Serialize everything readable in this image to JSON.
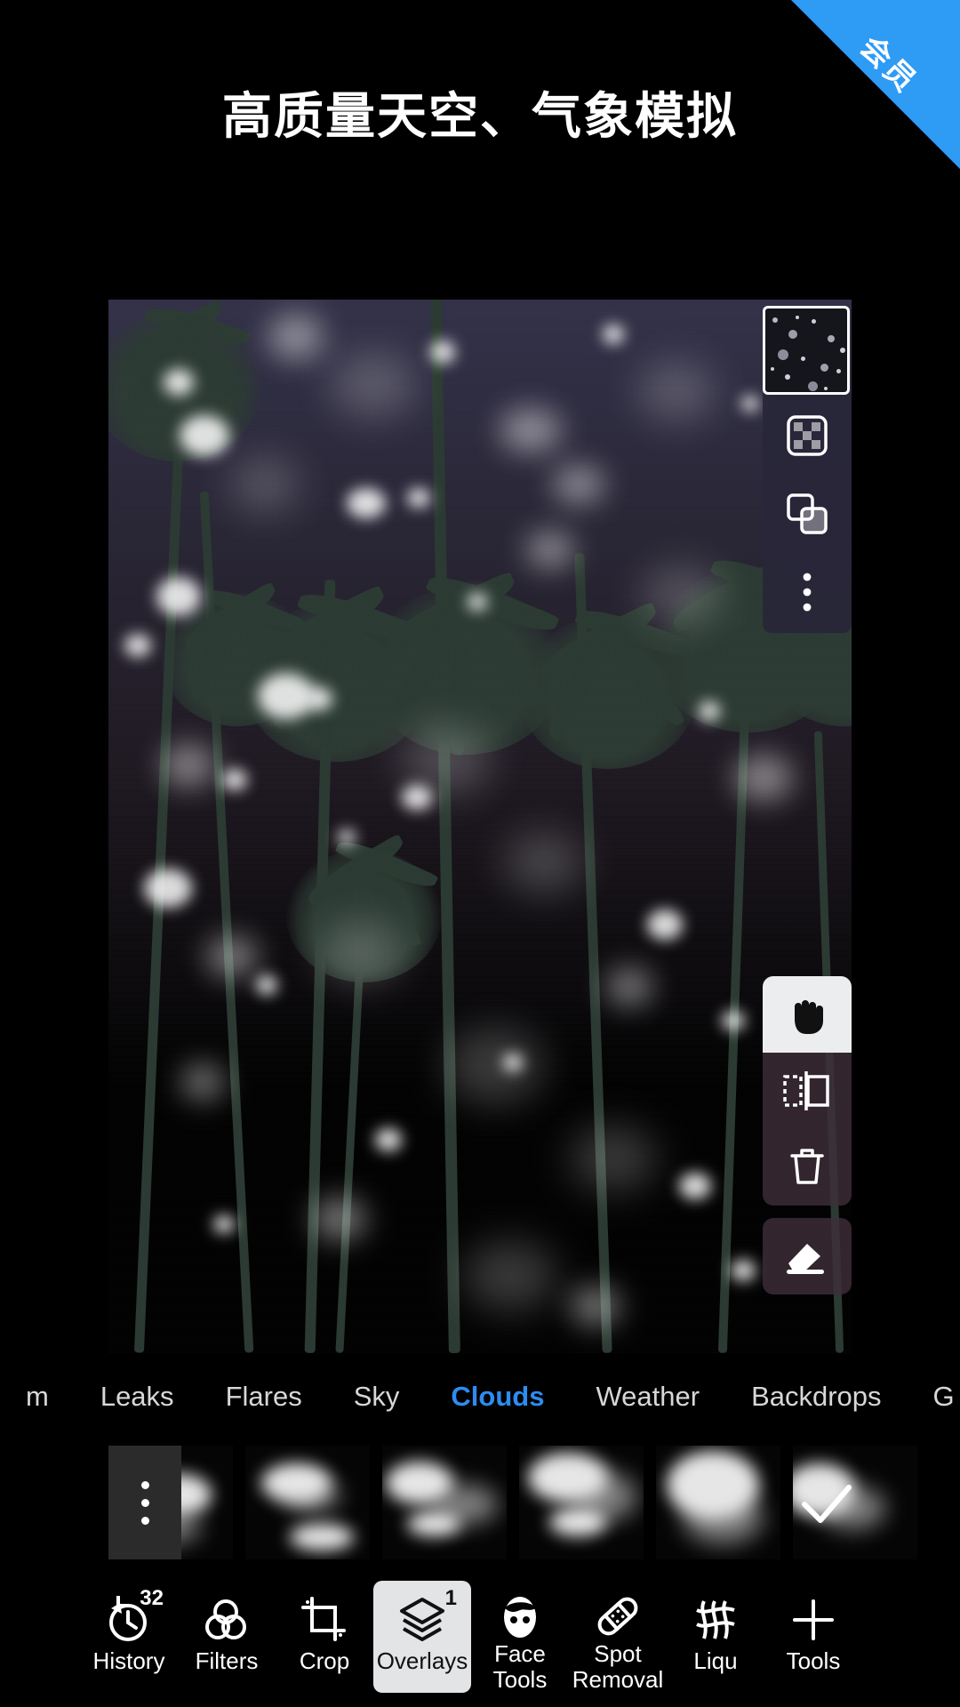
{
  "ribbon": {
    "label": "会员",
    "color": "#2e9bf5"
  },
  "headline": {
    "text": "高质量天空、气象模拟"
  },
  "canvas": {
    "name": "photo-canvas",
    "description": "palm trees silhouette against purple-to-pink gradient sky with bokeh light overlay"
  },
  "layers_panel": {
    "thumbnail_name": "overlay-layer-thumbnail",
    "buttons": [
      {
        "name": "opacity-mask-button",
        "icon": "checkerboard-icon"
      },
      {
        "name": "blend-mode-button",
        "icon": "overlapping-squares-icon"
      },
      {
        "name": "layer-more-button",
        "icon": "more-vertical-icon"
      }
    ]
  },
  "tool_panel": {
    "buttons": [
      {
        "name": "move-tool",
        "icon": "hand-icon",
        "selected": true
      },
      {
        "name": "flip-tool",
        "icon": "flip-horizontal-icon",
        "selected": false
      },
      {
        "name": "delete-tool",
        "icon": "trash-icon",
        "selected": false
      },
      {
        "name": "erase-tool",
        "icon": "eraser-icon",
        "selected": false
      }
    ]
  },
  "tabs": {
    "items": [
      {
        "label": "m",
        "active": false,
        "clipped": true
      },
      {
        "label": "Leaks",
        "active": false
      },
      {
        "label": "Flares",
        "active": false
      },
      {
        "label": "Sky",
        "active": false
      },
      {
        "label": "Clouds",
        "active": true
      },
      {
        "label": "Weather",
        "active": false
      },
      {
        "label": "Backdrops",
        "active": false
      },
      {
        "label": "G",
        "active": false,
        "clipped": true
      }
    ],
    "active_color": "#2d8cf0"
  },
  "carousel": {
    "more_button": "overlay-more-options",
    "confirm_button": "confirm-check-button",
    "thumbnails": [
      {
        "name": "cloud-thumb-1"
      },
      {
        "name": "cloud-thumb-2"
      },
      {
        "name": "cloud-thumb-3"
      },
      {
        "name": "cloud-thumb-4"
      },
      {
        "name": "cloud-thumb-5"
      },
      {
        "name": "cloud-thumb-6"
      }
    ]
  },
  "bottom_bar": {
    "items": [
      {
        "label": "History",
        "icon": "history-clock-icon",
        "badge": "32",
        "selected": false
      },
      {
        "label": "Filters",
        "icon": "three-circles-icon",
        "badge": "",
        "selected": false
      },
      {
        "label": "Crop",
        "icon": "crop-icon",
        "badge": "",
        "selected": false
      },
      {
        "label": "Overlays",
        "icon": "layers-icon",
        "badge": "1",
        "selected": true
      },
      {
        "label": "Face\nTools",
        "icon": "face-icon",
        "badge": "",
        "selected": false
      },
      {
        "label": "Spot\nRemoval",
        "icon": "bandage-icon",
        "badge": "",
        "selected": false
      },
      {
        "label": "Liqu",
        "icon": "liquify-grid-icon",
        "badge": "",
        "selected": false,
        "clipped": true
      },
      {
        "label": "Tools",
        "icon": "plus-icon",
        "badge": "",
        "selected": false
      }
    ]
  }
}
